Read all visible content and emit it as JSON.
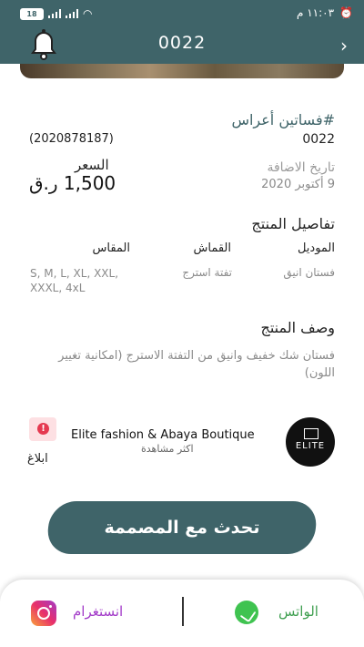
{
  "status_bar": {
    "time": "١١:٠٣ م",
    "battery": "18"
  },
  "header": {
    "title": "0022"
  },
  "product": {
    "name": "#فساتين أعراس",
    "code": "0022",
    "sku": "(2020878187)",
    "price_label": "السعر",
    "price": "1,500 ر.ق",
    "date_label": "تاريخ الاضافة",
    "date_value": "9 أكتوبر 2020"
  },
  "details": {
    "title": "تفاصيل المنتج",
    "columns": [
      {
        "header": "الموديل",
        "value": "فستان انيق"
      },
      {
        "header": "القماش",
        "value": "تفتة استرج"
      },
      {
        "header": "المقاس",
        "value": "S, M, L, XL, XXL, XXXL, 4xL"
      }
    ]
  },
  "description": {
    "title": "وصف المنتج",
    "text": "فستان شك خفيف وانيق من التفتة الاسترج (امكانية تغيير اللون)"
  },
  "store": {
    "name": "Elite fashion & Abaya Boutique",
    "subtitle": "اكثر مشاهدة",
    "logo_text": "ELITE",
    "report_label": "ابلاغ"
  },
  "cta": {
    "label": "تحدث مع المصممة"
  },
  "bottom": {
    "whatsapp_label": "الواتس",
    "instagram_label": "انستغرام"
  },
  "colors": {
    "primary": "#3f6469",
    "whatsapp": "#3fc350",
    "instagram": "#a23ac8"
  },
  "icons": [
    "bell-icon",
    "chevron-right-icon",
    "report-icon",
    "whatsapp-icon",
    "instagram-icon"
  ]
}
